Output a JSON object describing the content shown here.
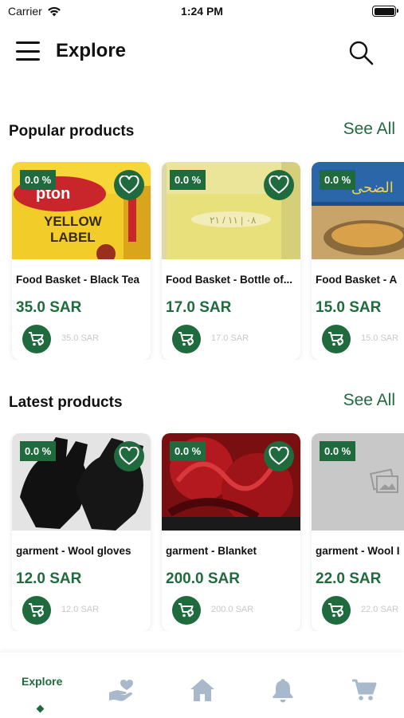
{
  "status_bar": {
    "carrier": "Carrier",
    "time": "1:24 PM",
    "battery_level": 1.0
  },
  "header": {
    "title": "Explore"
  },
  "popular": {
    "title": "Popular products",
    "see_all": "See All",
    "items": [
      {
        "discount": "0.0 %",
        "name": "Food Basket - Black Tea",
        "price": "35.0 SAR",
        "old_price": "35.0 SAR"
      },
      {
        "discount": "0.0 %",
        "name": "Food Basket - Bottle of...",
        "price": "17.0 SAR",
        "old_price": "17.0 SAR"
      },
      {
        "discount": "0.0 %",
        "name": "Food Basket - A",
        "price": "15.0 SAR",
        "old_price": "15.0 SAR"
      }
    ]
  },
  "latest": {
    "title": "Latest products",
    "see_all": "See All",
    "items": [
      {
        "discount": "0.0 %",
        "name": "garment - Wool gloves",
        "price": "12.0 SAR",
        "old_price": "12.0 SAR"
      },
      {
        "discount": "0.0 %",
        "name": "garment - Blanket",
        "price": "200.0 SAR",
        "old_price": "200.0 SAR"
      },
      {
        "discount": "0.0 %",
        "name": "garment - Wool I",
        "price": "22.0 SAR",
        "old_price": "22.0 SAR"
      }
    ]
  },
  "tab_bar": {
    "items": [
      {
        "label": "Explore",
        "icon": "explore",
        "active": true
      },
      {
        "label": "",
        "icon": "heart-hand-icon"
      },
      {
        "label": "",
        "icon": "home-icon"
      },
      {
        "label": "",
        "icon": "bell-icon"
      },
      {
        "label": "",
        "icon": "cart-icon"
      }
    ]
  },
  "colors": {
    "accent": "#1f6b3d",
    "inactive_icon": "#a9b9cc"
  }
}
